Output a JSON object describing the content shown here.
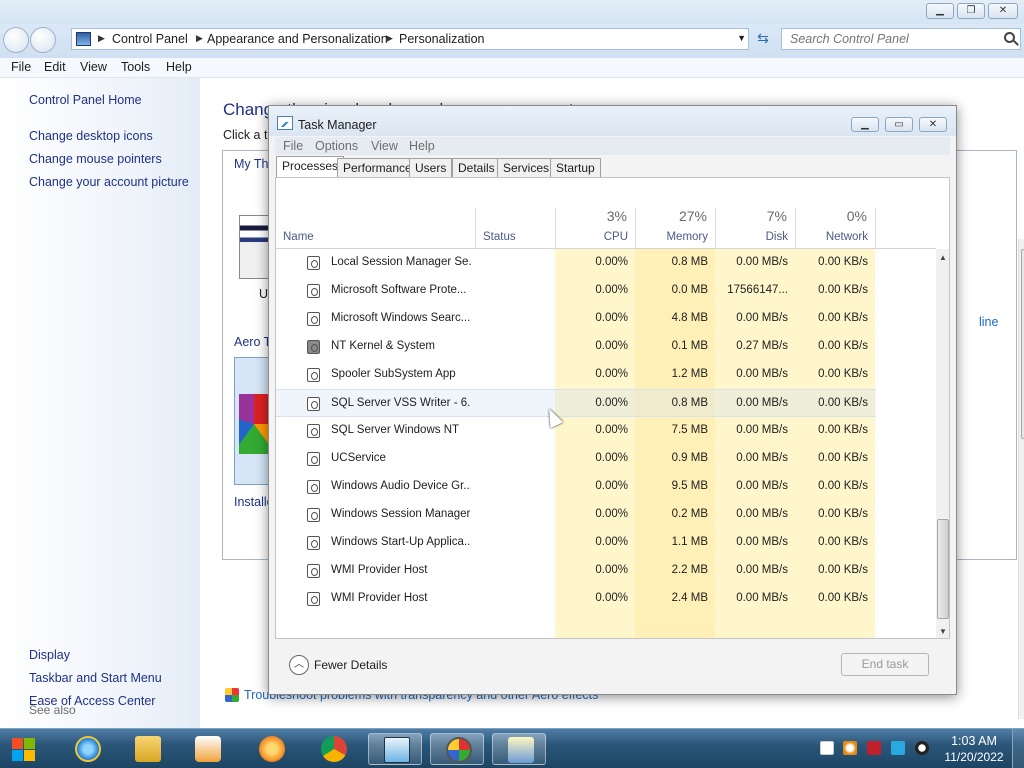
{
  "control_panel": {
    "breadcrumb": [
      "Control Panel",
      "Appearance and Personalization",
      "Personalization"
    ],
    "search_placeholder": "Search Control Panel",
    "menu": [
      "File",
      "Edit",
      "View",
      "Tools",
      "Help"
    ],
    "left_nav": {
      "home": "Control Panel Home",
      "links": [
        "Change desktop icons",
        "Change mouse pointers",
        "Change your account picture"
      ],
      "see_also_label": "See also",
      "see_also_links": [
        "Display",
        "Taskbar and Start Menu",
        "Ease of Access Center"
      ]
    },
    "heading_partial": "Change the visual and sounds on your computer",
    "subtext_partial": "Click a t",
    "my_themes_partial": "My Th",
    "theme_label_partial": "U",
    "aero_label_partial": "Aero T",
    "installed_label_partial": "Installe",
    "online_link_partial": "line",
    "troubleshoot_link": "Troubleshoot problems with transparency and other Aero effects"
  },
  "task_manager": {
    "title": "Task Manager",
    "menu": [
      "File",
      "Options",
      "View",
      "Help"
    ],
    "tabs": [
      "Processes",
      "Performance",
      "Users",
      "Details",
      "Services",
      "Startup"
    ],
    "active_tab": "Processes",
    "columns": {
      "name": "Name",
      "status": "Status",
      "cpu": {
        "label": "CPU",
        "pct": "3%"
      },
      "memory": {
        "label": "Memory",
        "pct": "27%"
      },
      "disk": {
        "label": "Disk",
        "pct": "7%"
      },
      "network": {
        "label": "Network",
        "pct": "0%"
      }
    },
    "processes": [
      {
        "name": "Local Session Manager Se...",
        "cpu": "0.00%",
        "memory": "0.8 MB",
        "disk": "0.00 MB/s",
        "network": "0.00 KB/s"
      },
      {
        "name": "Microsoft Software Prote...",
        "cpu": "0.00%",
        "memory": "0.0 MB",
        "disk": "17566147...",
        "network": "0.00 KB/s"
      },
      {
        "name": "Microsoft Windows Searc...",
        "cpu": "0.00%",
        "memory": "4.8 MB",
        "disk": "0.00 MB/s",
        "network": "0.00 KB/s"
      },
      {
        "name": "NT Kernel & System",
        "cpu": "0.00%",
        "memory": "0.1 MB",
        "disk": "0.27 MB/s",
        "network": "0.00 KB/s"
      },
      {
        "name": "Spooler SubSystem App",
        "cpu": "0.00%",
        "memory": "1.2 MB",
        "disk": "0.00 MB/s",
        "network": "0.00 KB/s"
      },
      {
        "name": "SQL Server VSS Writer - 6...",
        "cpu": "0.00%",
        "memory": "0.8 MB",
        "disk": "0.00 MB/s",
        "network": "0.00 KB/s"
      },
      {
        "name": "SQL Server Windows NT",
        "cpu": "0.00%",
        "memory": "7.5 MB",
        "disk": "0.00 MB/s",
        "network": "0.00 KB/s"
      },
      {
        "name": "UCService",
        "cpu": "0.00%",
        "memory": "0.9 MB",
        "disk": "0.00 MB/s",
        "network": "0.00 KB/s"
      },
      {
        "name": "Windows Audio Device Gr...",
        "cpu": "0.00%",
        "memory": "9.5 MB",
        "disk": "0.00 MB/s",
        "network": "0.00 KB/s"
      },
      {
        "name": "Windows Session Manager",
        "cpu": "0.00%",
        "memory": "0.2 MB",
        "disk": "0.00 MB/s",
        "network": "0.00 KB/s"
      },
      {
        "name": "Windows Start-Up Applica...",
        "cpu": "0.00%",
        "memory": "1.1 MB",
        "disk": "0.00 MB/s",
        "network": "0.00 KB/s"
      },
      {
        "name": "WMI Provider Host",
        "cpu": "0.00%",
        "memory": "2.2 MB",
        "disk": "0.00 MB/s",
        "network": "0.00 KB/s"
      },
      {
        "name": "WMI Provider Host",
        "cpu": "0.00%",
        "memory": "2.4 MB",
        "disk": "0.00 MB/s",
        "network": "0.00 KB/s"
      }
    ],
    "hovered_row": 5,
    "fewer_details": "Fewer Details",
    "end_task": "End task"
  },
  "taskbar": {
    "pinned": [
      "internet-explorer-icon",
      "file-explorer-icon",
      "media-player-icon",
      "app-orange-icon",
      "chrome-icon",
      "task-manager-icon",
      "app-wheel-icon",
      "control-panel-icon"
    ],
    "clock_time": "1:03 AM",
    "clock_date": "11/20/2022"
  },
  "colors": {
    "link": "#1e3287",
    "cpu_col_bg": "#fff6cc",
    "mem_col_bg": "#fff0b8",
    "taskbar": "#2b5679"
  }
}
